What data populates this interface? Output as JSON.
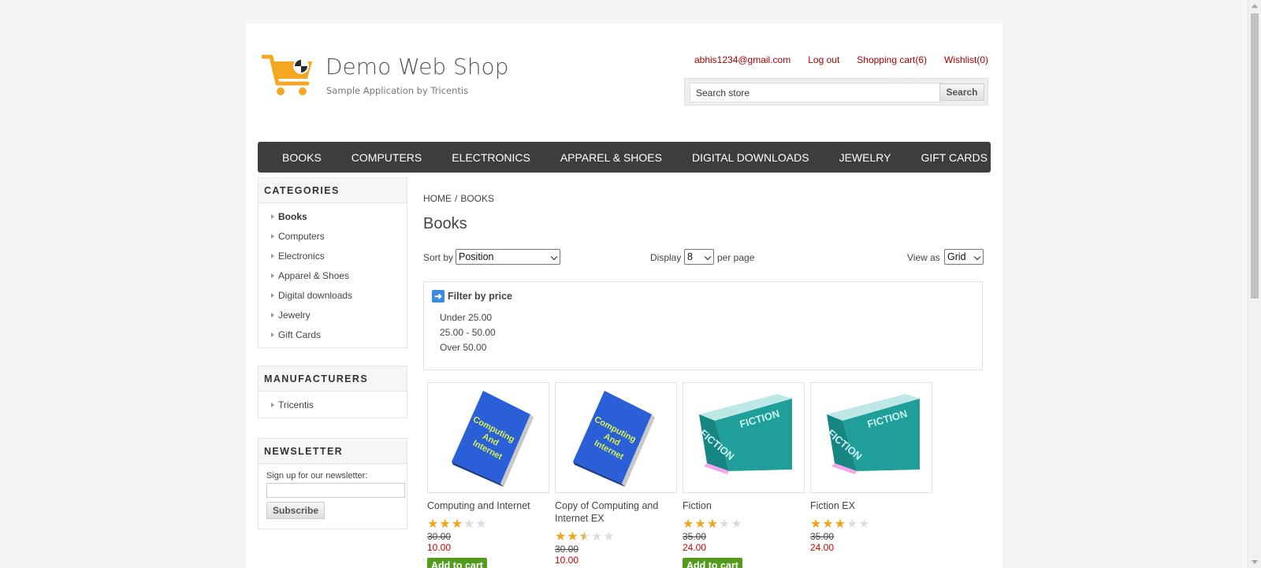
{
  "header": {
    "title": "Demo Web Shop",
    "subtitle": "Sample Application by Tricentis",
    "links": {
      "account": "abhis1234@gmail.com",
      "logout": "Log out",
      "cart": "Shopping cart(6)",
      "wishlist": "Wishlist(0)"
    },
    "search": {
      "value": "Search store",
      "button": "Search"
    }
  },
  "top_menu": [
    "BOOKS",
    "COMPUTERS",
    "ELECTRONICS",
    "APPAREL & SHOES",
    "DIGITAL DOWNLOADS",
    "JEWELRY",
    "GIFT CARDS"
  ],
  "sidebar": {
    "categories": {
      "title": "CATEGORIES",
      "items": [
        "Books",
        "Computers",
        "Electronics",
        "Apparel & Shoes",
        "Digital downloads",
        "Jewelry",
        "Gift Cards"
      ],
      "active": "Books"
    },
    "manufacturers": {
      "title": "MANUFACTURERS",
      "items": [
        "Tricentis"
      ]
    },
    "newsletter": {
      "title": "NEWSLETTER",
      "label": "Sign up for our newsletter:",
      "button": "Subscribe"
    }
  },
  "breadcrumb": {
    "home": "HOME",
    "sep": "/",
    "current": "BOOKS"
  },
  "page_title": "Books",
  "controls": {
    "sort_label": "Sort by",
    "sort_value": "Position",
    "display_label": "Display",
    "display_value": "8",
    "per_page_label": "per page",
    "view_label": "View as",
    "view_value": "Grid"
  },
  "filter": {
    "title": "Filter by price",
    "options": [
      "Under 25.00",
      "25.00 - 50.00",
      "Over 50.00"
    ]
  },
  "products": [
    {
      "title": "Computing and Internet",
      "rating": 3,
      "old_price": "30.00",
      "price": "10.00",
      "button": "Add to cart",
      "cover_text": "Computing And Internet",
      "cover_color": "#2a5fd8"
    },
    {
      "title": "Copy of Computing and Internet EX",
      "rating": 2.5,
      "old_price": "30.00",
      "price": "10.00",
      "button": "",
      "cover_text": "Computing And Internet",
      "cover_color": "#2a5fd8"
    },
    {
      "title": "Fiction",
      "rating": 3,
      "old_price": "35.00",
      "price": "24.00",
      "button": "Add to cart",
      "cover_text": "FICTION",
      "cover_color": "#1f9e9a"
    },
    {
      "title": "Fiction EX",
      "rating": 3,
      "old_price": "35.00",
      "price": "24.00",
      "button": "",
      "cover_text": "FICTION",
      "cover_color": "#1f9e9a"
    }
  ],
  "colors": {
    "accent_red": "#a50000",
    "menu_bg": "#3d3d3d",
    "add_cart_green": "#549b1f",
    "price_red": "#c00000"
  }
}
